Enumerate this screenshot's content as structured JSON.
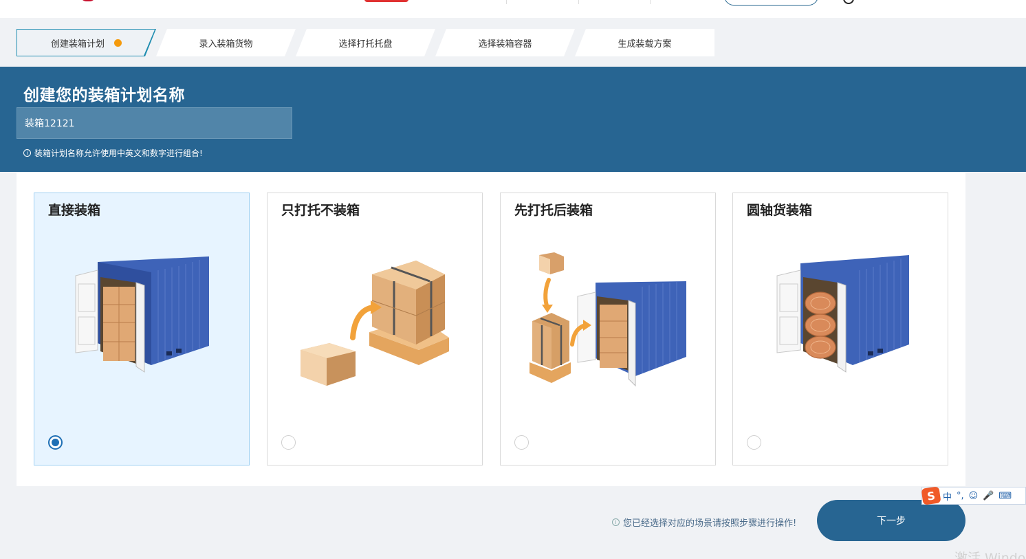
{
  "steps": [
    {
      "label": "创建装箱计划",
      "active": true
    },
    {
      "label": "录入装箱货物",
      "active": false
    },
    {
      "label": "选择打托托盘",
      "active": false
    },
    {
      "label": "选择装箱容器",
      "active": false
    },
    {
      "label": "生成装载方案",
      "active": false
    }
  ],
  "banner": {
    "title": "创建您的装箱计划名称",
    "plan_name_value": "装箱12121",
    "hint": "装箱计划名称允许使用中英文和数字进行组合!"
  },
  "options": [
    {
      "title": "直接装箱",
      "selected": true,
      "image_icon": "container-with-boxes-icon"
    },
    {
      "title": "只打托不装箱",
      "selected": false,
      "image_icon": "box-to-pallet-icon"
    },
    {
      "title": "先打托后装箱",
      "selected": false,
      "image_icon": "pallet-into-container-icon"
    },
    {
      "title": "圆轴货装箱",
      "selected": false,
      "image_icon": "container-with-rolls-icon"
    }
  ],
  "footer": {
    "tip": "您已经选择对应的场景请按照步骤进行操作!",
    "next_label": "下一步"
  },
  "ime": {
    "logo": "S",
    "mode": "中",
    "punct": "°,"
  },
  "watermark": "激活 Windo",
  "colors": {
    "banner": "#276592",
    "accent": "#f59a0c",
    "selected_card": "#e7f4ff",
    "radio": "#1e6fb5"
  }
}
